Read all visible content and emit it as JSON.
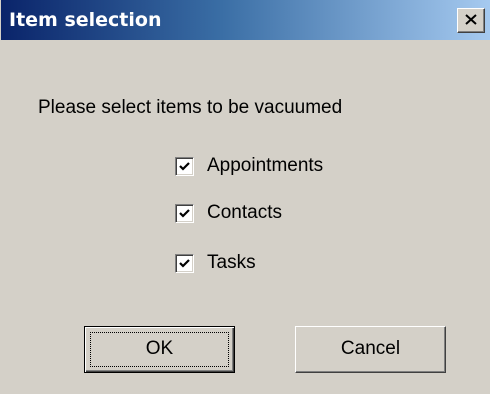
{
  "window": {
    "title": "Item selection",
    "close_icon": "close-icon"
  },
  "prompt": "Please select items to be vacuumed",
  "items": [
    {
      "label": "Appointments",
      "checked": true
    },
    {
      "label": "Contacts",
      "checked": true
    },
    {
      "label": "Tasks",
      "checked": true
    }
  ],
  "buttons": {
    "ok_label": "OK",
    "cancel_label": "Cancel"
  },
  "colors": {
    "title_gradient_start": "#0a246a",
    "title_gradient_end": "#a6caf0",
    "face": "#d4d0c8"
  }
}
